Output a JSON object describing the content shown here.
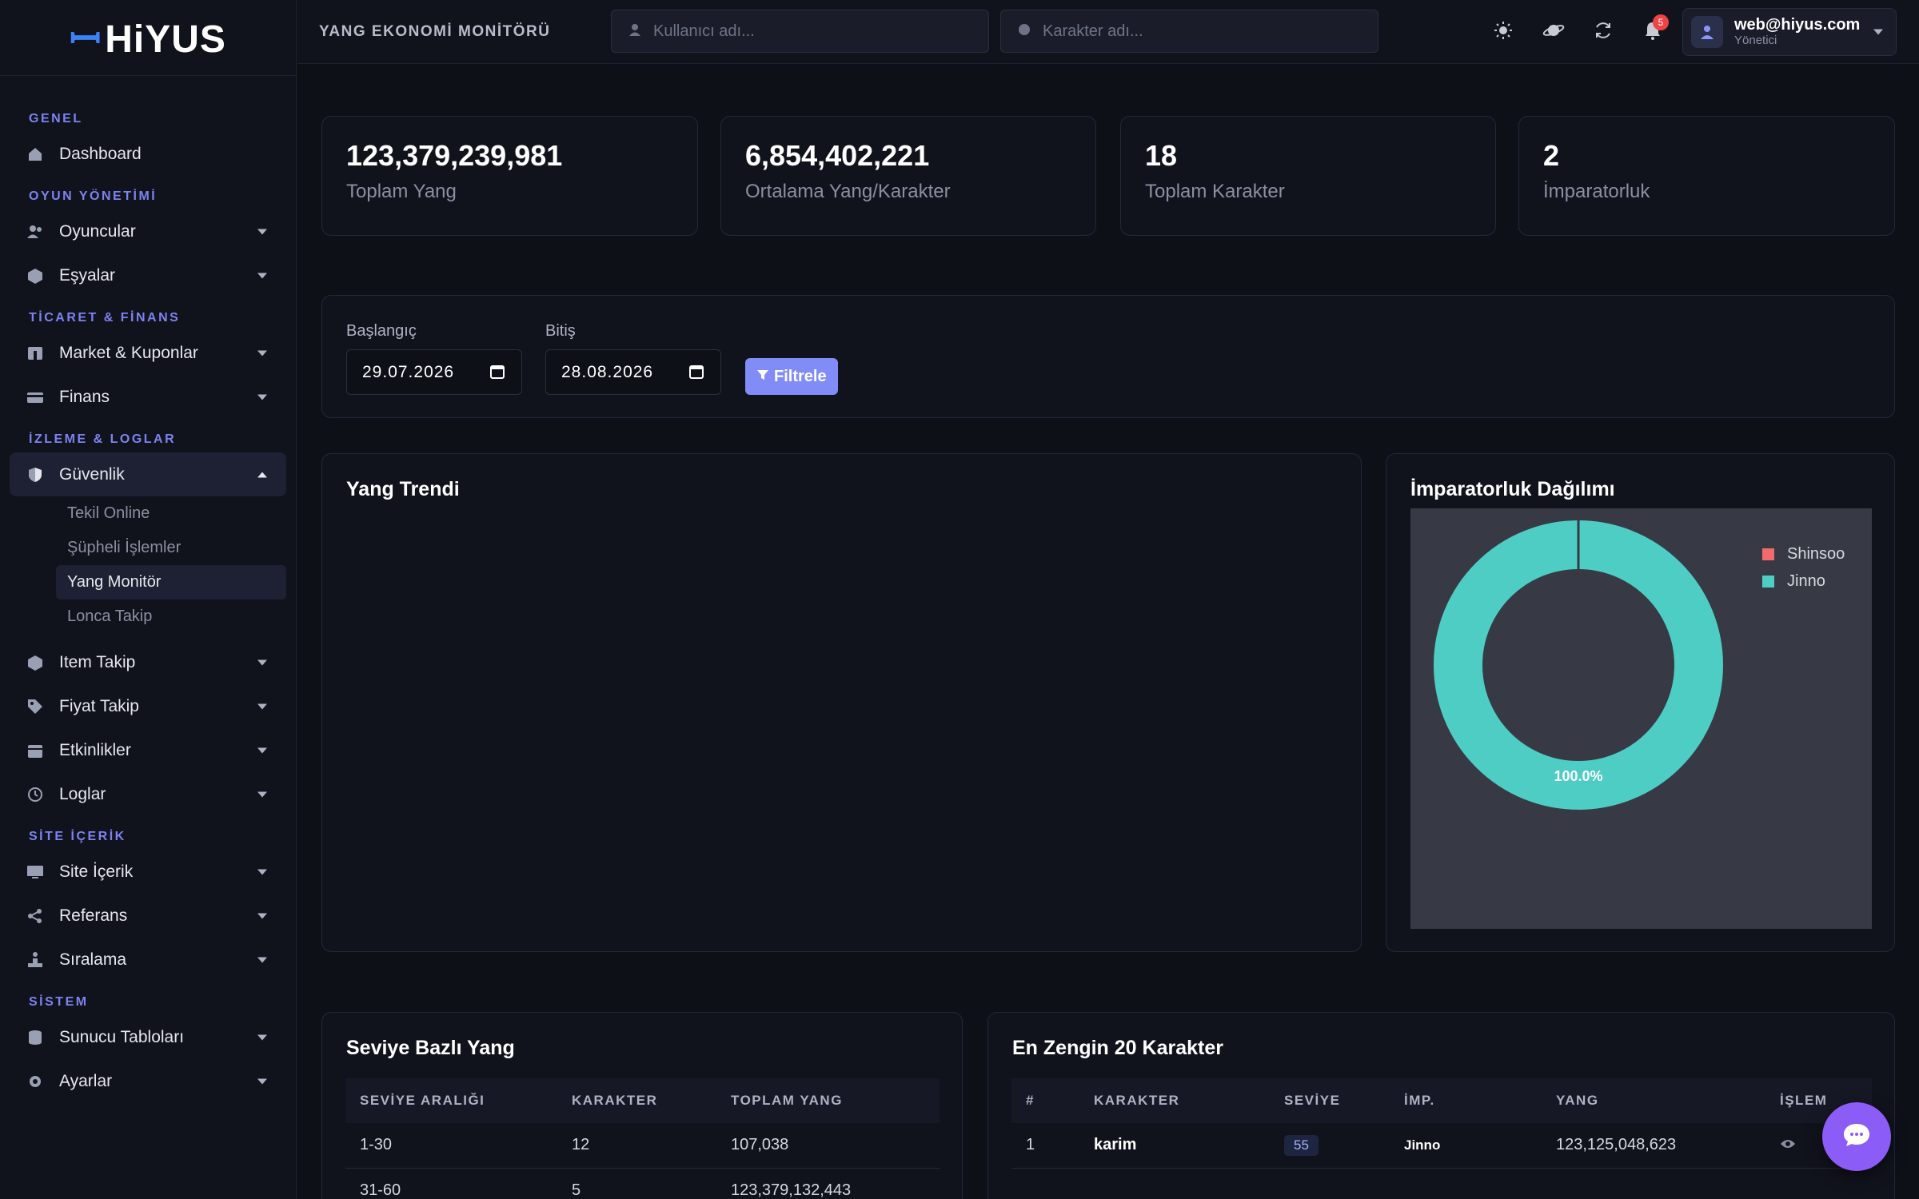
{
  "brand": {
    "name": "HiYUS"
  },
  "sidebar": {
    "sections": {
      "general": "GENEL",
      "game": "OYUN YÖNETİMİ",
      "trade": "TİCARET & FİNANS",
      "monitor": "İZLEME & LOGLAR",
      "site": "SİTE İÇERİK",
      "system": "SİSTEM"
    },
    "items": {
      "dashboard": "Dashboard",
      "players": "Oyuncular",
      "items": "Eşyalar",
      "market": "Market & Kuponlar",
      "finance": "Finans",
      "security": "Güvenlik",
      "item_track": "Item Takip",
      "price_track": "Fiyat Takip",
      "events": "Etkinlikler",
      "logs": "Loglar",
      "site_content": "Site İçerik",
      "referral": "Referans",
      "ranking": "Sıralama",
      "server_tables": "Sunucu Tabloları",
      "settings": "Ayarlar"
    },
    "security_sub": {
      "online": "Tekil Online",
      "suspicious": "Şüpheli İşlemler",
      "yang_monitor": "Yang Monitör",
      "guild": "Lonca Takip"
    }
  },
  "topbar": {
    "page_name": "YANG EKONOMİ MONİTÖRÜ",
    "user_placeholder": "Kullanıcı adı...",
    "char_placeholder": "Karakter adı...",
    "notif_count": "5",
    "user_email": "web@hiyus.com",
    "user_role": "Yönetici"
  },
  "stats": [
    {
      "value": "123,379,239,981",
      "label": "Toplam Yang"
    },
    {
      "value": "6,854,402,221",
      "label": "Ortalama Yang/Karakter"
    },
    {
      "value": "18",
      "label": "Toplam Karakter"
    },
    {
      "value": "2",
      "label": "İmparatorluk"
    }
  ],
  "filter": {
    "start_label": "Başlangıç",
    "start_value": "29.07.2026",
    "end_label": "Bitiş",
    "end_value": "28.08.2026",
    "button": "Filtrele"
  },
  "trend": {
    "title": "Yang Trendi"
  },
  "empire": {
    "title": "İmparatorluk Dağılımı",
    "slice_label": "100.0%",
    "colors": {
      "Shinsoo": "#f26b6b",
      "Jinno": "#4ecdc4"
    }
  },
  "chart_data": {
    "type": "pie",
    "categories": [
      "Shinsoo",
      "Jinno"
    ],
    "values": [
      0,
      100
    ],
    "title": "İmparatorluk Dağılımı",
    "legend": "top-right"
  },
  "level_table": {
    "title": "Seviye Bazlı Yang",
    "headers": [
      "SEVİYE ARALIĞI",
      "KARAKTER",
      "TOPLAM YANG"
    ],
    "rows": [
      [
        "1-30",
        "12",
        "107,038"
      ],
      [
        "31-60",
        "5",
        "123,379,132,443"
      ]
    ]
  },
  "rich_table": {
    "title": "En Zengin 20 Karakter",
    "headers": [
      "#",
      "KARAKTER",
      "SEVİYE",
      "İMP.",
      "YANG",
      "İŞLEM"
    ],
    "rows": [
      [
        "1",
        "karim",
        "55",
        "Jinno",
        "123,125,048,623"
      ]
    ]
  }
}
